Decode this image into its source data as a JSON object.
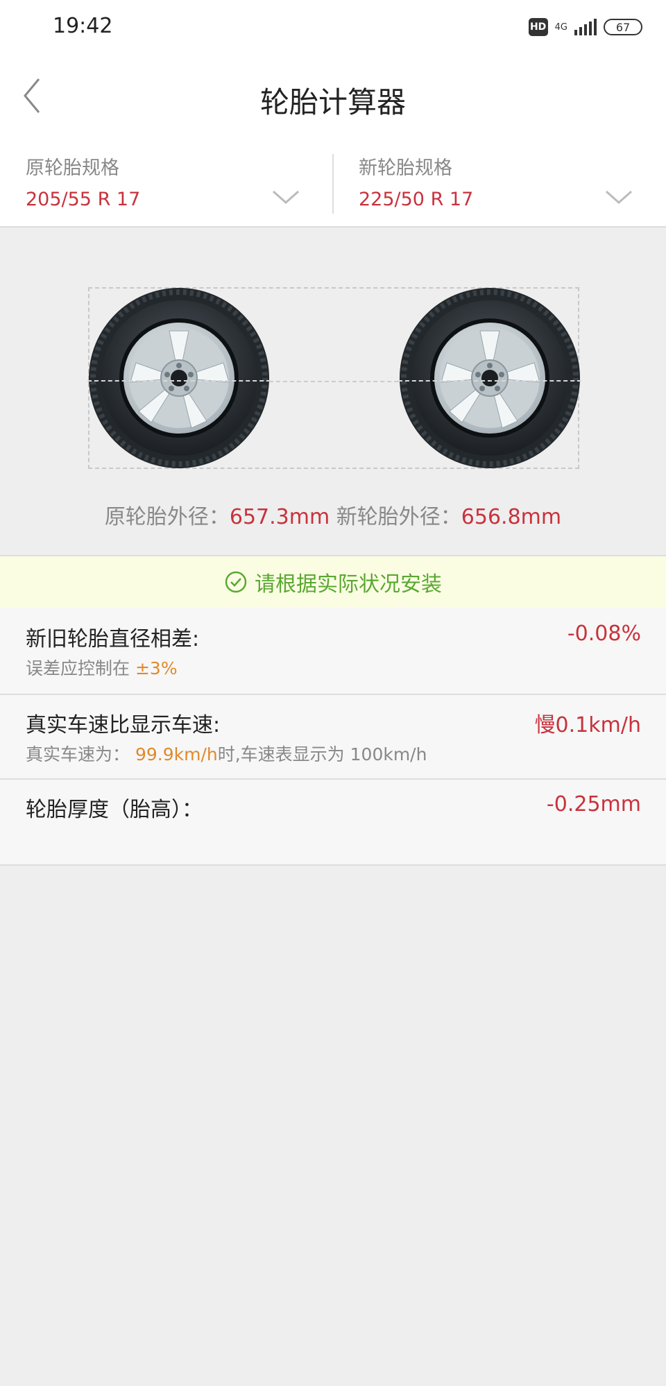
{
  "status_bar": {
    "time": "19:42",
    "hd": "HD",
    "network": "4G",
    "battery": "67"
  },
  "header": {
    "title": "轮胎计算器"
  },
  "specs": {
    "original": {
      "label": "原轮胎规格",
      "value": "205/55 R 17"
    },
    "new": {
      "label": "新轮胎规格",
      "value": "225/50 R 17"
    }
  },
  "diameters": {
    "original_label": "原轮胎外径：",
    "original_value": "657.3mm",
    "new_label": "新轮胎外径：",
    "new_value": "656.8mm"
  },
  "notice": {
    "text": "请根据实际状况安装"
  },
  "results": {
    "diameter_diff": {
      "title": "新旧轮胎直径相差:",
      "value": "-0.08%",
      "sub_prefix": "误差应控制在",
      "sub_highlight": "±3%"
    },
    "speed": {
      "title": "真实车速比显示车速:",
      "value": "慢0.1km/h",
      "sub_prefix": "真实车速为：",
      "sub_highlight": "99.9km/h",
      "sub_suffix": "时,车速表显示为 100km/h"
    },
    "thickness": {
      "title": "轮胎厚度（胎高）：",
      "value": "-0.25mm"
    }
  },
  "colors": {
    "accent_red": "#c8323c",
    "notice_green": "#5aa832",
    "highlight_orange": "#e08a2c"
  }
}
